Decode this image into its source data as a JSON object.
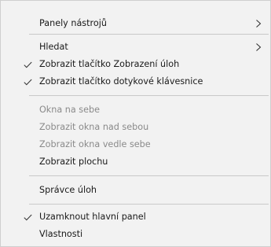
{
  "menu": {
    "items": [
      {
        "label": "Panely nástrojů",
        "checked": false,
        "submenu": true,
        "disabled": false
      },
      {
        "label": "Hledat",
        "checked": false,
        "submenu": true,
        "disabled": false
      },
      {
        "label": "Zobrazit tlačítko Zobrazení úloh",
        "checked": true,
        "submenu": false,
        "disabled": false
      },
      {
        "label": "Zobrazit tlačítko dotykové klávesnice",
        "checked": true,
        "submenu": false,
        "disabled": false
      },
      {
        "label": "Okna na sebe",
        "checked": false,
        "submenu": false,
        "disabled": true
      },
      {
        "label": "Zobrazit okna nad sebou",
        "checked": false,
        "submenu": false,
        "disabled": true
      },
      {
        "label": "Zobrazit okna vedle sebe",
        "checked": false,
        "submenu": false,
        "disabled": true
      },
      {
        "label": "Zobrazit plochu",
        "checked": false,
        "submenu": false,
        "disabled": false
      },
      {
        "label": "Správce úloh",
        "checked": false,
        "submenu": false,
        "disabled": false
      },
      {
        "label": "Uzamknout hlavní panel",
        "checked": true,
        "submenu": false,
        "disabled": false
      },
      {
        "label": "Vlastnosti",
        "checked": false,
        "submenu": false,
        "disabled": false
      }
    ]
  },
  "icons": {
    "check": "checkmark-icon",
    "submenu": "chevron-right-icon"
  },
  "colors": {
    "background": "#f2f2f2",
    "text": "#1a1a1a",
    "disabled_text": "#8a8a8a",
    "separator": "#c9c9c9",
    "border": "#cfcfcf"
  }
}
